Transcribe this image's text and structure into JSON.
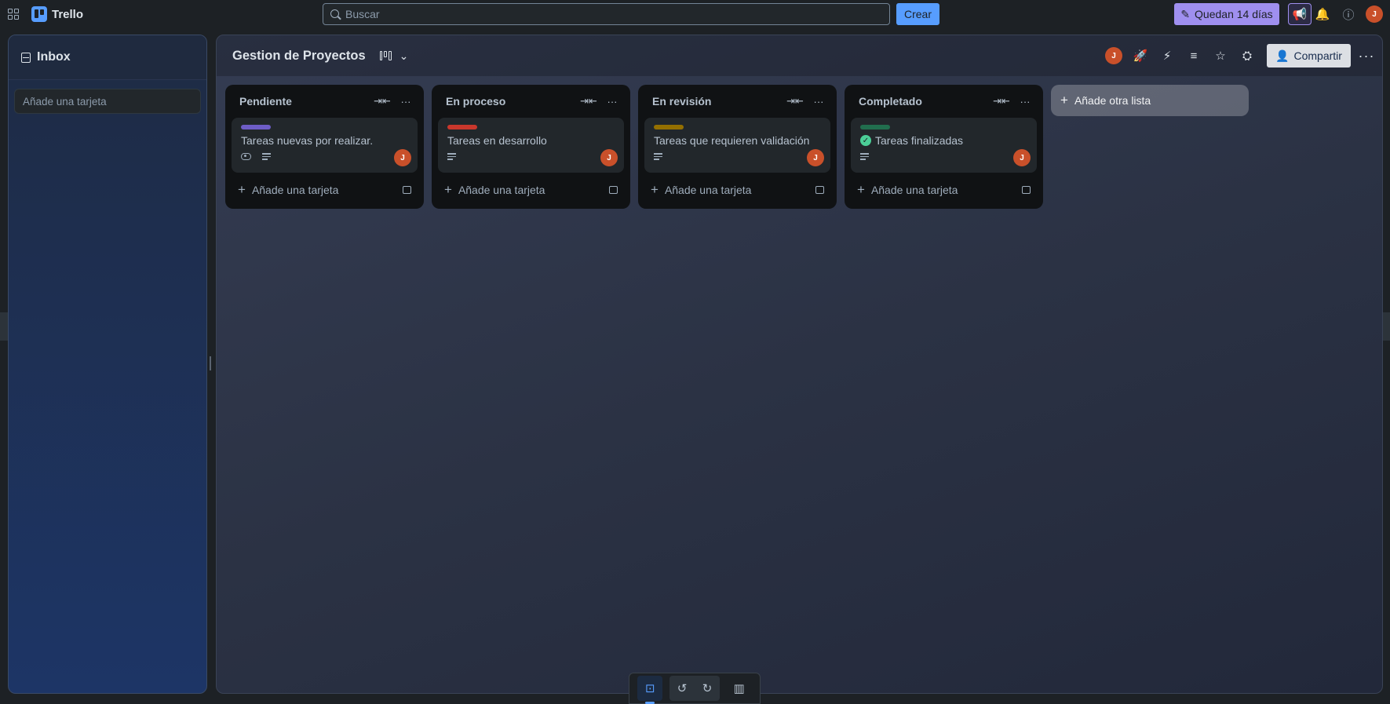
{
  "app": {
    "name": "Trello"
  },
  "topbar": {
    "search_placeholder": "Buscar",
    "create_label": "Crear",
    "trial_label": "Quedan 14 días",
    "avatar_initial": "J"
  },
  "inbox": {
    "title": "Inbox",
    "add_card_label": "Añade una tarjeta"
  },
  "board": {
    "title": "Gestion de Proyectos",
    "member_initial": "J",
    "share_label": "Compartir",
    "add_list_label": "Añade otra lista",
    "lists": [
      {
        "title": "Pendiente",
        "card": {
          "label_color": "#6e5dc6",
          "title": "Tareas nuevas por realizar.",
          "watching": true,
          "has_description": true,
          "avatar_initial": "J",
          "done": false
        },
        "add_card_label": "Añade una tarjeta"
      },
      {
        "title": "En proceso",
        "card": {
          "label_color": "#c9372c",
          "title": "Tareas en desarrollo",
          "watching": false,
          "has_description": true,
          "avatar_initial": "J",
          "done": false
        },
        "add_card_label": "Añade una tarjeta"
      },
      {
        "title": "En revisión",
        "card": {
          "label_color": "#946f00",
          "title": "Tareas que requieren validación",
          "watching": false,
          "has_description": true,
          "avatar_initial": "J",
          "done": false
        },
        "add_card_label": "Añade una tarjeta"
      },
      {
        "title": "Completado",
        "card": {
          "label_color": "#216e4e",
          "title": "Tareas finalizadas",
          "watching": false,
          "has_description": true,
          "avatar_initial": "J",
          "done": true
        },
        "add_card_label": "Añade una tarjeta"
      }
    ]
  },
  "colors": {
    "accent": "#579dff",
    "trial": "#9f8fef",
    "avatar": "#c9502a"
  }
}
